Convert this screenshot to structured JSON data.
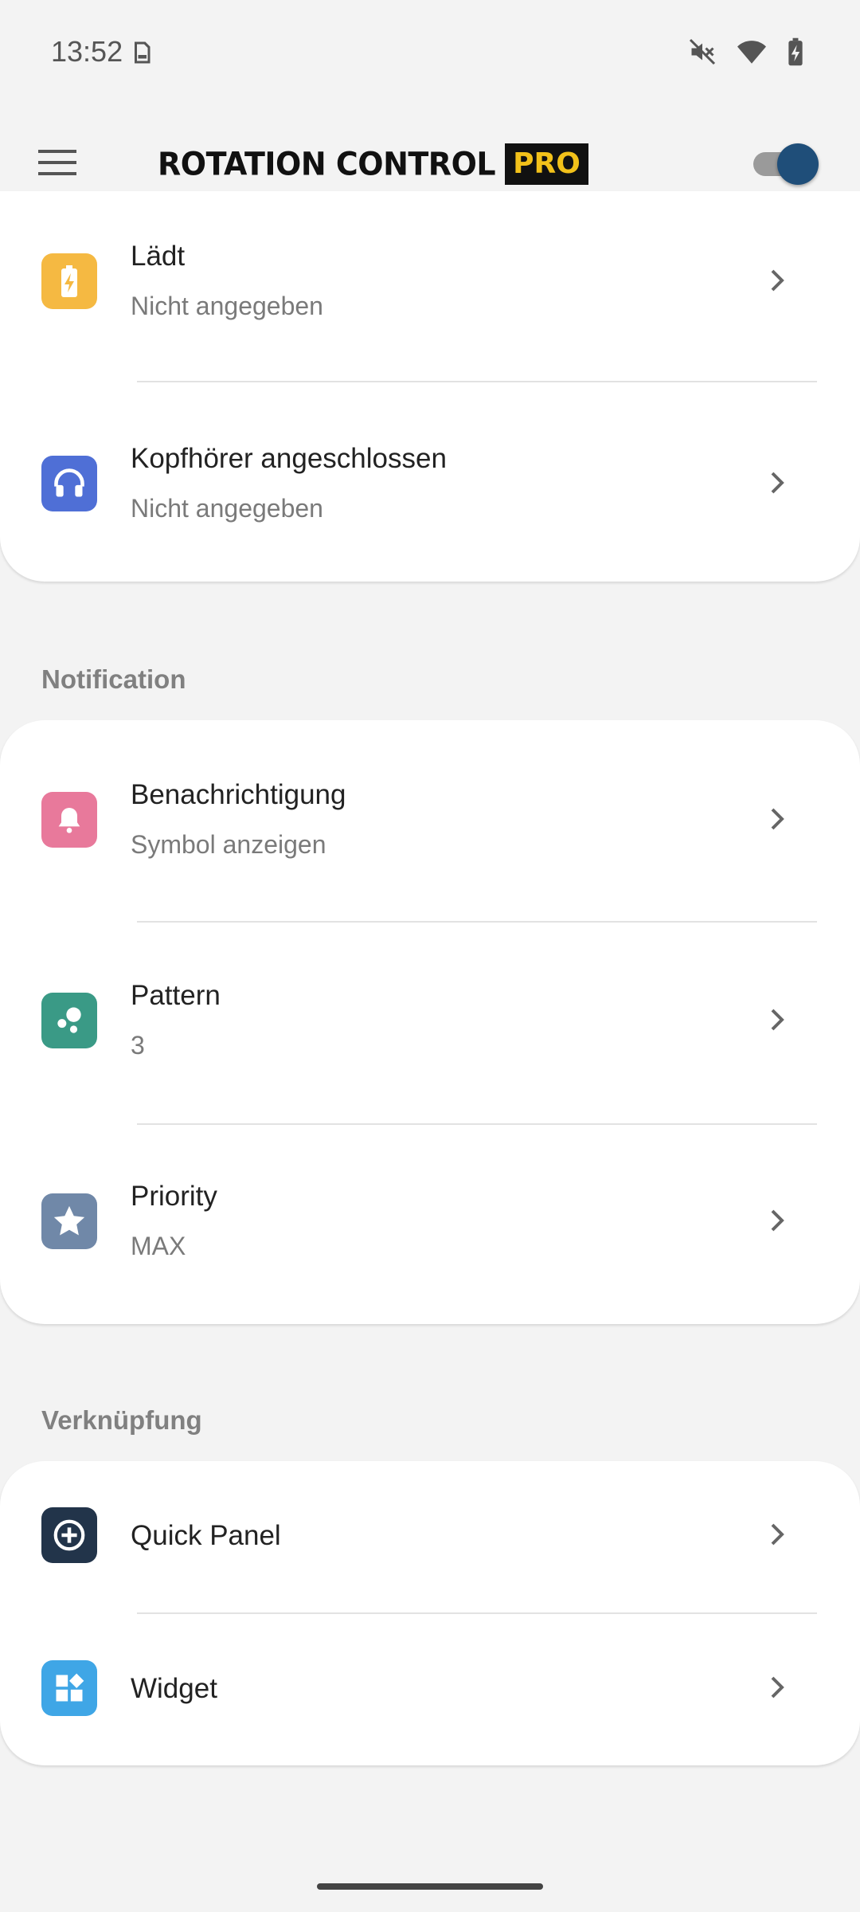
{
  "status_bar": {
    "time": "13:52",
    "icons": [
      "sd-card-icon",
      "mute-icon",
      "wifi-icon",
      "battery-charging-icon"
    ]
  },
  "app_bar": {
    "logo_main": "ROTATION CONTROL",
    "logo_badge": "PRO",
    "toggle_on": true,
    "colors": {
      "logo_badge_text": "#f2c11a",
      "toggle_thumb": "#1f4e79"
    }
  },
  "top_card": {
    "items": [
      {
        "title": "Lädt",
        "subtitle": "Nicht angegeben",
        "icon": "battery-charging-icon",
        "color": "#f5b942"
      },
      {
        "title": "Kopfhörer angeschlossen",
        "subtitle": "Nicht angegeben",
        "icon": "headphones-icon",
        "color": "#4f6fd6"
      }
    ]
  },
  "notification": {
    "header": "Notification",
    "items": [
      {
        "title": "Benachrichtigung",
        "subtitle": "Symbol anzeigen",
        "icon": "bell-icon",
        "color": "#e8799b"
      },
      {
        "title": "Pattern",
        "subtitle": "3",
        "icon": "pattern-icon",
        "color": "#3a9a86"
      },
      {
        "title": "Priority",
        "subtitle": "MAX",
        "icon": "star-icon",
        "color": "#7088a8"
      }
    ]
  },
  "shortcut": {
    "header": "Verknüpfung",
    "items": [
      {
        "title": "Quick Panel",
        "icon": "add-circle-icon",
        "color": "#22344a"
      },
      {
        "title": "Widget",
        "icon": "widgets-icon",
        "color": "#3fa6e6"
      }
    ]
  }
}
